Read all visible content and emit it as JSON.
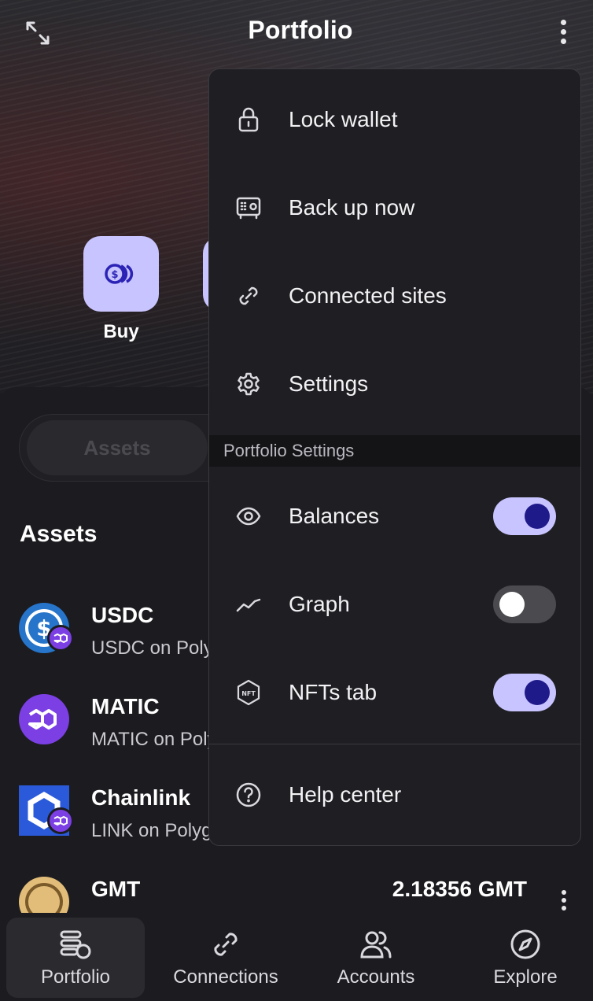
{
  "header": {
    "title": "Portfolio"
  },
  "actions": [
    {
      "label": "Buy",
      "icon": "coins-icon"
    }
  ],
  "tabs": {
    "active_label": "Assets"
  },
  "assets_section": {
    "heading": "Assets",
    "items": [
      {
        "name": "USDC",
        "subtitle": "USDC on Polygon",
        "icon": "usdc-icon",
        "balance": ""
      },
      {
        "name": "MATIC",
        "subtitle": "MATIC on Polygon",
        "icon": "matic-icon",
        "balance": ""
      },
      {
        "name": "Chainlink",
        "subtitle": "LINK on Polygon",
        "icon": "chainlink-icon",
        "balance": ""
      },
      {
        "name": "GMT",
        "subtitle": "",
        "icon": "gmt-icon",
        "balance": "2.18356 GMT"
      }
    ]
  },
  "menu": {
    "items": [
      {
        "label": "Lock wallet",
        "icon": "lock-icon"
      },
      {
        "label": "Back up now",
        "icon": "safe-icon"
      },
      {
        "label": "Connected sites",
        "icon": "link-icon"
      },
      {
        "label": "Settings",
        "icon": "gear-icon"
      }
    ],
    "section_title": "Portfolio Settings",
    "toggles": [
      {
        "label": "Balances",
        "icon": "eye-icon",
        "on": true
      },
      {
        "label": "Graph",
        "icon": "graph-icon",
        "on": false
      },
      {
        "label": "NFTs tab",
        "icon": "nft-icon",
        "on": true
      }
    ],
    "help": {
      "label": "Help center",
      "icon": "question-icon"
    }
  },
  "bottom_nav": [
    {
      "label": "Portfolio",
      "icon": "portfolio-icon",
      "active": true
    },
    {
      "label": "Connections",
      "icon": "link-icon",
      "active": false
    },
    {
      "label": "Accounts",
      "icon": "users-icon",
      "active": false
    },
    {
      "label": "Explore",
      "icon": "compass-icon",
      "active": false
    }
  ],
  "colors": {
    "accent": "#c8c4ff",
    "accent_dark": "#1f1a8a",
    "background": "#1c1c20",
    "menu_bg": "#1f1f23"
  }
}
